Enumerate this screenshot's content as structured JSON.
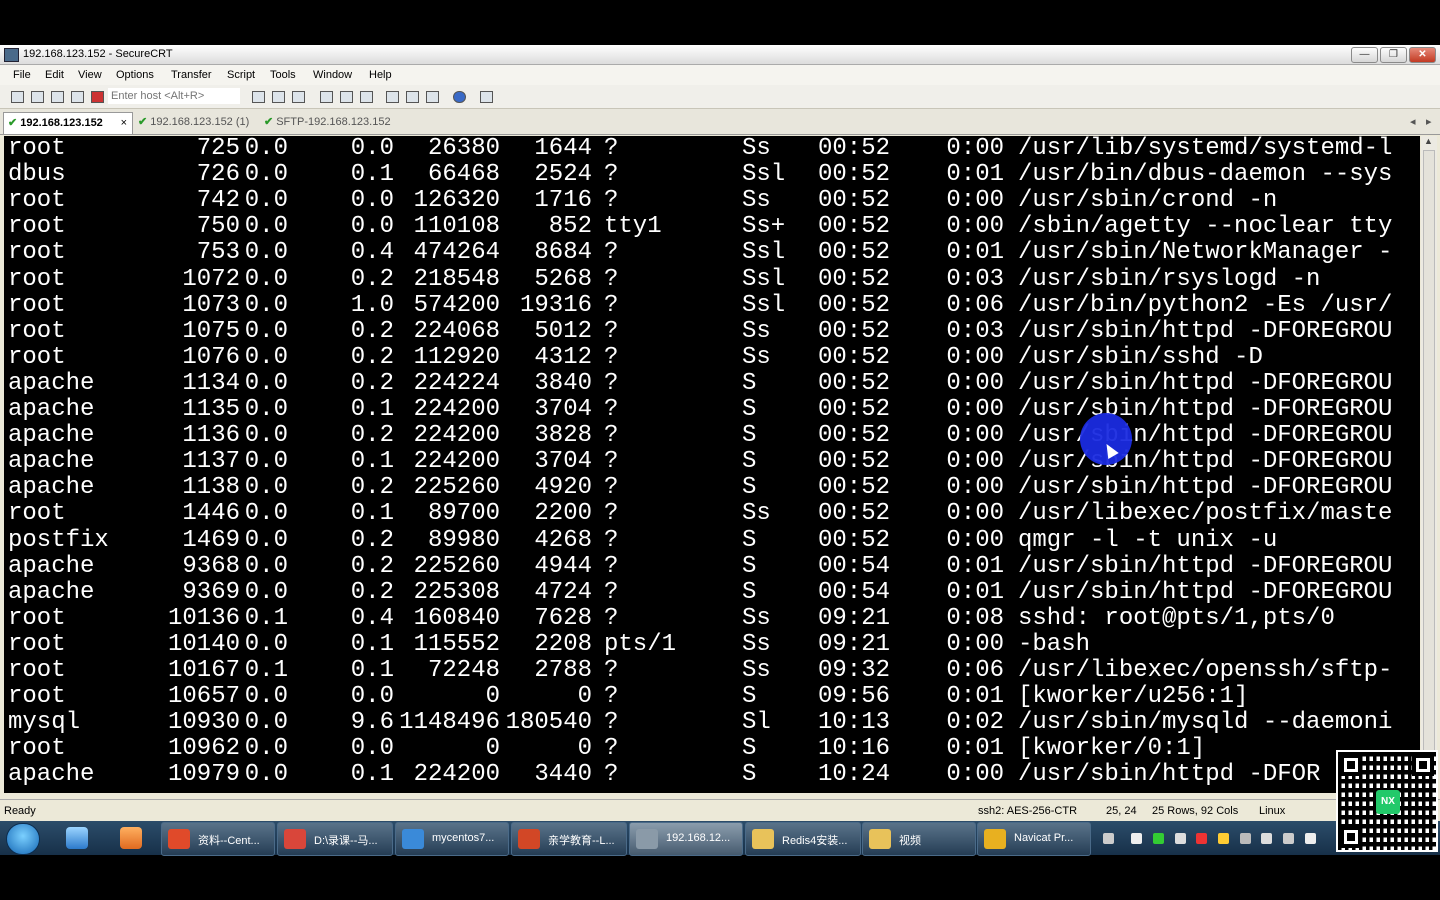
{
  "window": {
    "title": "192.168.123.152 - SecureCRT"
  },
  "menu": [
    "File",
    "Edit",
    "View",
    "Options",
    "Transfer",
    "Script",
    "Tools",
    "Window",
    "Help"
  ],
  "toolbar": {
    "host_placeholder": "Enter host <Alt+R>"
  },
  "tabs": [
    {
      "label": "192.168.123.152",
      "close": "×"
    },
    {
      "label": "192.168.123.152 (1)"
    },
    {
      "label": "SFTP-192.168.123.152"
    }
  ],
  "terminal": {
    "rows": [
      [
        "root",
        "725",
        "0.0",
        "0.0",
        "26380",
        "1644",
        "?",
        "Ss",
        "00:52",
        "0:00",
        "/usr/lib/systemd/systemd-l"
      ],
      [
        "dbus",
        "726",
        "0.0",
        "0.1",
        "66468",
        "2524",
        "?",
        "Ssl",
        "00:52",
        "0:01",
        "/usr/bin/dbus-daemon --sys"
      ],
      [
        "root",
        "742",
        "0.0",
        "0.0",
        "126320",
        "1716",
        "?",
        "Ss",
        "00:52",
        "0:00",
        "/usr/sbin/crond -n"
      ],
      [
        "root",
        "750",
        "0.0",
        "0.0",
        "110108",
        "852",
        "tty1",
        "Ss+",
        "00:52",
        "0:00",
        "/sbin/agetty --noclear tty"
      ],
      [
        "root",
        "753",
        "0.0",
        "0.4",
        "474264",
        "8684",
        "?",
        "Ssl",
        "00:52",
        "0:01",
        "/usr/sbin/NetworkManager -"
      ],
      [
        "root",
        "1072",
        "0.0",
        "0.2",
        "218548",
        "5268",
        "?",
        "Ssl",
        "00:52",
        "0:03",
        "/usr/sbin/rsyslogd -n"
      ],
      [
        "root",
        "1073",
        "0.0",
        "1.0",
        "574200",
        "19316",
        "?",
        "Ssl",
        "00:52",
        "0:06",
        "/usr/bin/python2 -Es /usr/"
      ],
      [
        "root",
        "1075",
        "0.0",
        "0.2",
        "224068",
        "5012",
        "?",
        "Ss",
        "00:52",
        "0:03",
        "/usr/sbin/httpd -DFOREGROU"
      ],
      [
        "root",
        "1076",
        "0.0",
        "0.2",
        "112920",
        "4312",
        "?",
        "Ss",
        "00:52",
        "0:00",
        "/usr/sbin/sshd -D"
      ],
      [
        "apache",
        "1134",
        "0.0",
        "0.2",
        "224224",
        "3840",
        "?",
        "S",
        "00:52",
        "0:00",
        "/usr/sbin/httpd -DFOREGROU"
      ],
      [
        "apache",
        "1135",
        "0.0",
        "0.1",
        "224200",
        "3704",
        "?",
        "S",
        "00:52",
        "0:00",
        "/usr/sbin/httpd -DFOREGROU"
      ],
      [
        "apache",
        "1136",
        "0.0",
        "0.2",
        "224200",
        "3828",
        "?",
        "S",
        "00:52",
        "0:00",
        "/usr/sbin/httpd -DFOREGROU"
      ],
      [
        "apache",
        "1137",
        "0.0",
        "0.1",
        "224200",
        "3704",
        "?",
        "S",
        "00:52",
        "0:00",
        "/usr/sbin/httpd -DFOREGROU"
      ],
      [
        "apache",
        "1138",
        "0.0",
        "0.2",
        "225260",
        "4920",
        "?",
        "S",
        "00:52",
        "0:00",
        "/usr/sbin/httpd -DFOREGROU"
      ],
      [
        "root",
        "1446",
        "0.0",
        "0.1",
        "89700",
        "2200",
        "?",
        "Ss",
        "00:52",
        "0:00",
        "/usr/libexec/postfix/maste"
      ],
      [
        "postfix",
        "1469",
        "0.0",
        "0.2",
        "89980",
        "4268",
        "?",
        "S",
        "00:52",
        "0:00",
        "qmgr -l -t unix -u"
      ],
      [
        "apache",
        "9368",
        "0.0",
        "0.2",
        "225260",
        "4944",
        "?",
        "S",
        "00:54",
        "0:01",
        "/usr/sbin/httpd -DFOREGROU"
      ],
      [
        "apache",
        "9369",
        "0.0",
        "0.2",
        "225308",
        "4724",
        "?",
        "S",
        "00:54",
        "0:01",
        "/usr/sbin/httpd -DFOREGROU"
      ],
      [
        "root",
        "10136",
        "0.1",
        "0.4",
        "160840",
        "7628",
        "?",
        "Ss",
        "09:21",
        "0:08",
        "sshd: root@pts/1,pts/0"
      ],
      [
        "root",
        "10140",
        "0.0",
        "0.1",
        "115552",
        "2208",
        "pts/1",
        "Ss",
        "09:21",
        "0:00",
        "-bash"
      ],
      [
        "root",
        "10167",
        "0.1",
        "0.1",
        "72248",
        "2788",
        "?",
        "Ss",
        "09:32",
        "0:06",
        "/usr/libexec/openssh/sftp-"
      ],
      [
        "root",
        "10657",
        "0.0",
        "0.0",
        "0",
        "0",
        "?",
        "S",
        "09:56",
        "0:01",
        "[kworker/u256:1]"
      ],
      [
        "mysql",
        "10930",
        "0.0",
        "9.6",
        "1148496",
        "180540",
        "?",
        "Sl",
        "10:13",
        "0:02",
        "/usr/sbin/mysqld --daemoni"
      ],
      [
        "root",
        "10962",
        "0.0",
        "0.0",
        "0",
        "0",
        "?",
        "S",
        "10:16",
        "0:01",
        "[kworker/0:1]"
      ],
      [
        "apache",
        "10979",
        "0.0",
        "0.1",
        "224200",
        "3440",
        "?",
        "S",
        "10:24",
        "0:00",
        "/usr/sbin/httpd -DFOR"
      ]
    ]
  },
  "status": {
    "ready": "Ready",
    "cipher": "ssh2: AES-256-CTR",
    "position": "25,  24",
    "size": "25 Rows, 92 Cols",
    "os": "Linux"
  },
  "taskbar": {
    "items": [
      {
        "label": "资料--Cent...",
        "color": "#e04a2a"
      },
      {
        "label": "D:\\录课--马...",
        "color": "#d9463a"
      },
      {
        "label": "mycentos7...",
        "color": "#3a8ad9"
      },
      {
        "label": "亲学教育--L...",
        "color": "#d24726"
      },
      {
        "label": "192.168.12...",
        "color": "#8a9aa8"
      },
      {
        "label": "Redis4安装...",
        "color": "#e8c25a"
      },
      {
        "label": "视频",
        "color": "#e8c25a"
      },
      {
        "label": "Navicat Pr...",
        "color": "#e8b020"
      }
    ]
  },
  "qr": {
    "logo": "NX"
  }
}
